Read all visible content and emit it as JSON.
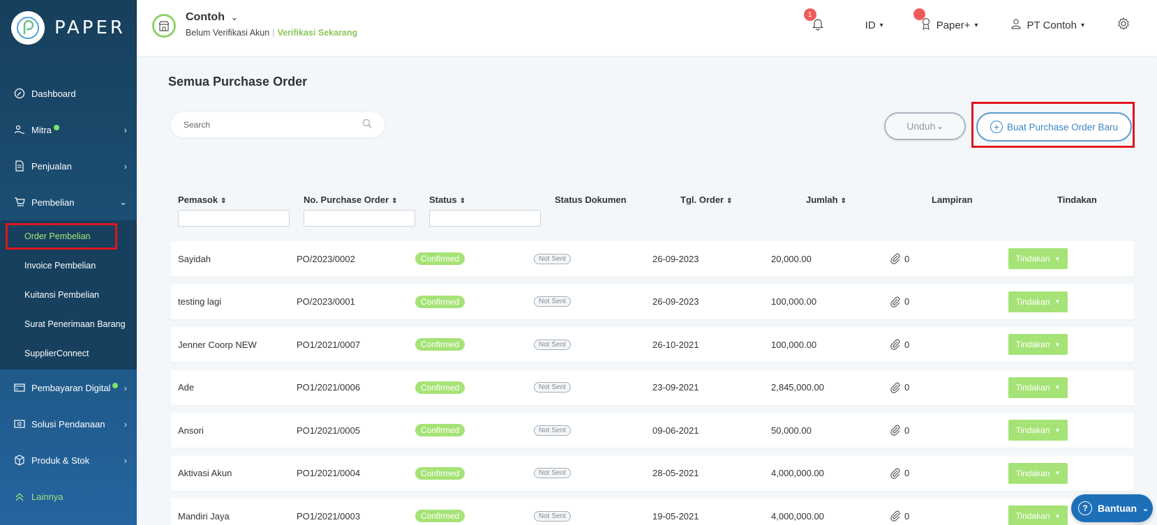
{
  "brand": {
    "name": "PAPER"
  },
  "sidebar": {
    "items": [
      {
        "label": "Dashboard",
        "icon": "dashboard-icon"
      },
      {
        "label": "Mitra",
        "icon": "users-icon",
        "dot": true,
        "chevron": "›"
      },
      {
        "label": "Penjualan",
        "icon": "document-icon",
        "chevron": "›"
      },
      {
        "label": "Pembelian",
        "icon": "cart-icon",
        "chevron": "⌄"
      }
    ],
    "submenu": [
      {
        "label": "Order Pembelian",
        "active": true
      },
      {
        "label": "Invoice Pembelian"
      },
      {
        "label": "Kuitansi Pembelian"
      },
      {
        "label": "Surat Penerimaan Barang"
      },
      {
        "label": "SupplierConnect"
      }
    ],
    "items2": [
      {
        "label": "Pembayaran Digital",
        "icon": "card-icon",
        "dot": true,
        "chevron": "›"
      },
      {
        "label": "Solusi Pendanaan",
        "icon": "money-icon",
        "chevron": "›"
      },
      {
        "label": "Produk & Stok",
        "icon": "box-icon",
        "chevron": "›"
      },
      {
        "label": "Lainnya",
        "icon": "chevrons-up-icon"
      }
    ]
  },
  "header": {
    "company": "Contoh",
    "unverified": "Belum Verifikasi Akun",
    "verify_link": "Verifikasi Sekarang",
    "notif_count": "1",
    "language": "ID",
    "plan": "Paper+",
    "account": "PT Contoh"
  },
  "main": {
    "title": "Semua Purchase Order",
    "search_placeholder": "Search",
    "download_label": "Unduh",
    "new_po_label": "Buat Purchase Order Baru",
    "columns": [
      "Pemasok",
      "No. Purchase Order",
      "Status",
      "Status Dokumen",
      "Tgl. Order",
      "Jumlah",
      "Lampiran",
      "Tindakan"
    ],
    "rows": [
      {
        "supplier": "Sayidah",
        "po": "PO/2023/0002",
        "status": "Confirmed",
        "doc": "Not Sent",
        "date": "26-09-2023",
        "amount": "20,000.00",
        "attach": "0",
        "action": "Tindakan"
      },
      {
        "supplier": "testing lagi",
        "po": "PO/2023/0001",
        "status": "Confirmed",
        "doc": "Not Sent",
        "date": "26-09-2023",
        "amount": "100,000.00",
        "attach": "0",
        "action": "Tindakan"
      },
      {
        "supplier": "Jenner Coorp NEW",
        "po": "PO1/2021/0007",
        "status": "Confirmed",
        "doc": "Not Sent",
        "date": "26-10-2021",
        "amount": "100,000.00",
        "attach": "0",
        "action": "Tindakan"
      },
      {
        "supplier": "Ade",
        "po": "PO1/2021/0006",
        "status": "Confirmed",
        "doc": "Not Sent",
        "date": "23-09-2021",
        "amount": "2,845,000.00",
        "attach": "0",
        "action": "Tindakan"
      },
      {
        "supplier": "Ansori",
        "po": "PO1/2021/0005",
        "status": "Confirmed",
        "doc": "Not Sent",
        "date": "09-06-2021",
        "amount": "50,000.00",
        "attach": "0",
        "action": "Tindakan"
      },
      {
        "supplier": "Aktivasi Akun",
        "po": "PO1/2021/0004",
        "status": "Confirmed",
        "doc": "Not Sent",
        "date": "28-05-2021",
        "amount": "4,000,000.00",
        "attach": "0",
        "action": "Tindakan"
      },
      {
        "supplier": "Mandiri Jaya",
        "po": "PO1/2021/0003",
        "status": "Confirmed",
        "doc": "Not Sent",
        "date": "19-05-2021",
        "amount": "4,000,000.00",
        "attach": "0",
        "action": "Tindakan"
      }
    ]
  },
  "help": {
    "label": "Bantuan"
  },
  "colors": {
    "accent_green": "#a6e377",
    "link_blue": "#3d86c4",
    "sidebar": "#1b4e72",
    "highlight_red": "#e0151d"
  }
}
